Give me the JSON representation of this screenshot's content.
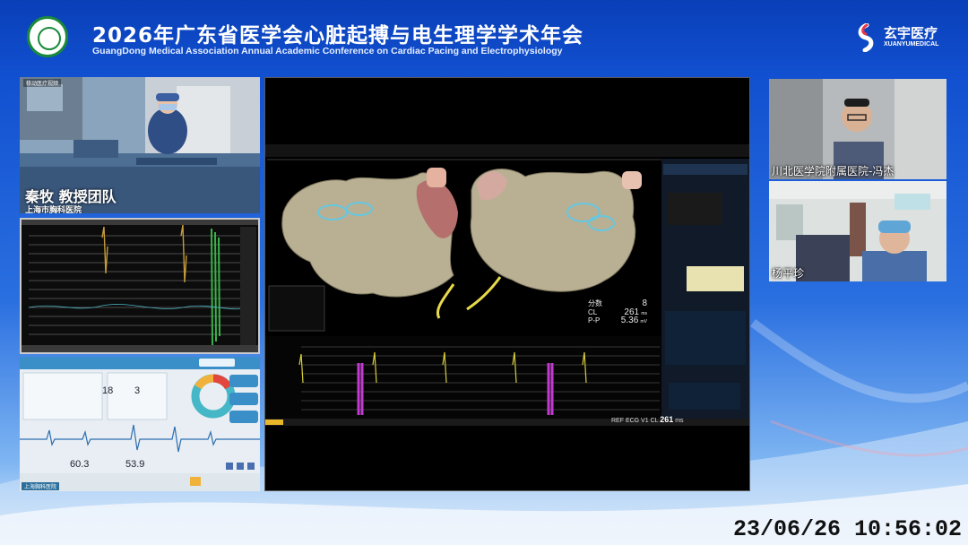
{
  "header": {
    "title": "2026年广东省医学会心脏起搏与电生理学学术年会",
    "subtitle": "GuangDong Medical Association Annual Academic Conference on Cardiac Pacing and Electrophysiology",
    "brand_cn": "玄宇医疗",
    "brand_en": "XUANYUMEDICAL"
  },
  "operating_room": {
    "corner_tag": "移动医疗视频",
    "speaker": "秦牧 教授团队",
    "hospital": "上海市胸科医院"
  },
  "monitor": {
    "value_a": "18",
    "value_b": "3",
    "value_c": "60.3",
    "value_d": "53.9",
    "corner_tag": "上海胸科医院"
  },
  "mapping": {
    "readout_label_1": "分数",
    "readout_value_1": "8",
    "readout_label_2": "CL",
    "readout_value_2": "261",
    "readout_unit_2": "ms",
    "readout_label_3": "P-P",
    "readout_value_3": "5.36",
    "readout_unit_3": "mV",
    "bottom_label": "REF ECG V1 CL",
    "bottom_value": "261",
    "bottom_unit": "ms"
  },
  "video_participants": [
    {
      "name": "川北医学院附属医院-冯杰"
    },
    {
      "name": "杨平珍"
    }
  ],
  "timestamp": "23/06/26 10:56:02",
  "colors": {
    "accent": "#1150d0",
    "brand_green": "#1a8a3a",
    "map_purple": "#c23bd1",
    "map_yellow": "#d8cf3a"
  }
}
